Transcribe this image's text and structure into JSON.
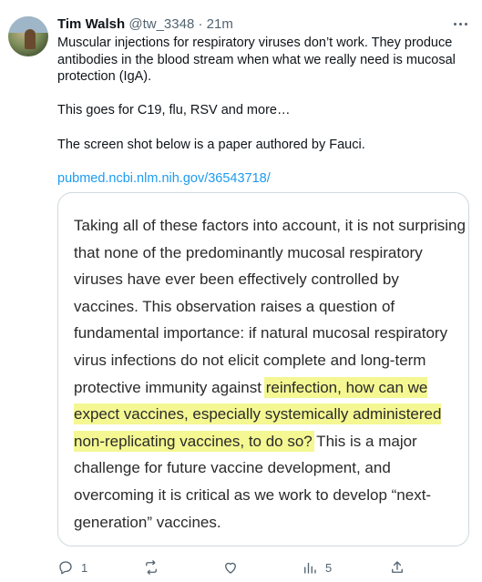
{
  "tweet": {
    "author_name": "Tim Walsh",
    "handle": "@tw_3348",
    "separator": "·",
    "time": "21m",
    "paragraph1": "Muscular injections for respiratory viruses don’t work. They produce antibodies in the blood stream when what we really need is mucosal protection (IgA).",
    "paragraph2": "This goes for C19, flu, RSV and more…",
    "paragraph3": "The screen shot below is a paper authored by Fauci.",
    "link": "pubmed.ncbi.nlm.nih.gov/36543718/"
  },
  "card": {
    "text_before": "Taking all of these factors into account, it is not surprising that none of the predominantly mucosal respiratory viruses have ever been effectively controlled by vaccines. This observation raises a question of fundamental importance: if natural mucosal respiratory virus infections do not elicit complete and long-term protective immunity against ",
    "text_highlighted": "reinfection, how can we expect vaccines, especially systemically administered non-replicating vaccines, to do so?",
    "text_after": " This is a major challenge for future vaccine development, and overcoming it is critical as we work to develop “next-generation” vaccines.",
    "highlight_color": "#f4f792"
  },
  "actions": {
    "reply_count": "1",
    "retweet_count": "",
    "like_count": "",
    "views_count": "5",
    "icons": [
      "reply-icon",
      "retweet-icon",
      "like-icon",
      "views-icon",
      "share-icon"
    ]
  }
}
